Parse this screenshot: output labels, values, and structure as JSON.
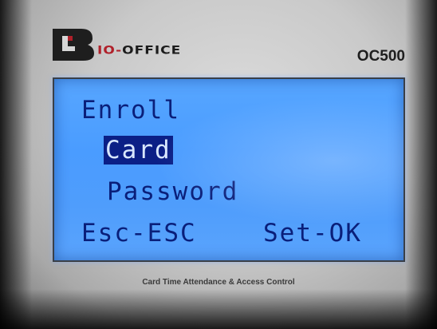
{
  "brand": {
    "logo_text_prefix": "IO-",
    "logo_text_suffix": "OFFICE",
    "model": "OC500"
  },
  "screen": {
    "title": "Enroll",
    "menu_items": [
      "Card",
      "Password"
    ],
    "selected_index": 0,
    "soft_keys": {
      "left": "Esc-ESC",
      "right": "Set-OK"
    }
  },
  "caption": "Card Time Attendance & Access Control",
  "colors": {
    "lcd_background": "#4a9cff",
    "lcd_text": "#0a1f7a",
    "selection_background": "#0b1f86",
    "logo_accent": "#b0202a"
  }
}
